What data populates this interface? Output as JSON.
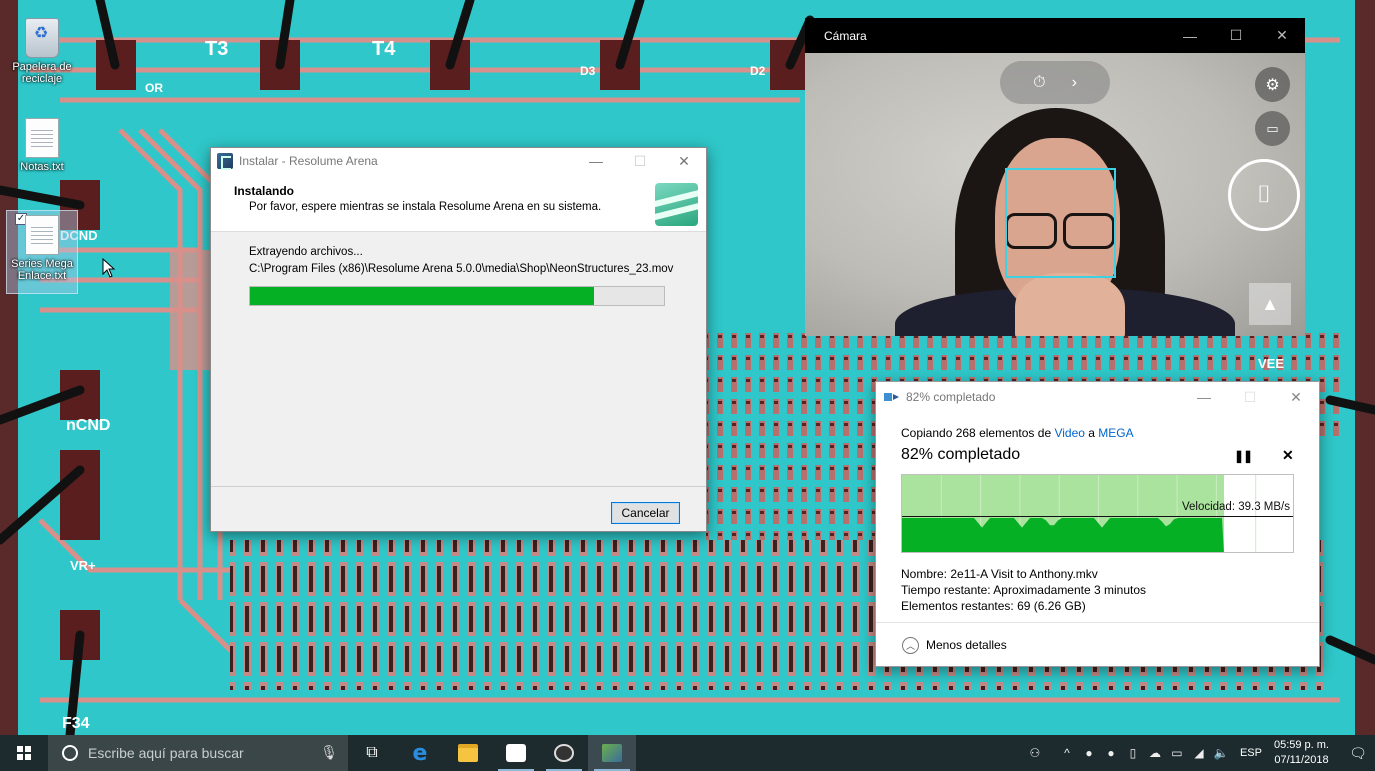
{
  "desktop": {
    "icons": [
      {
        "label": "Papelera de reciclaje",
        "icon": "recycle-bin-icon"
      },
      {
        "label": "Notas.txt",
        "icon": "text-file-icon"
      },
      {
        "label": "Series Mega Enlace.txt",
        "icon": "text-file-icon"
      }
    ],
    "wallpaper_text": [
      "T3",
      "T4",
      "OR",
      "DCND",
      "nCND",
      "VR+",
      "F34",
      "VEE",
      "D3",
      "D2"
    ]
  },
  "installer": {
    "title": "Instalar - Resolume Arena",
    "heading": "Instalando",
    "subheading": "Por favor, espere mientras se instala Resolume Arena en su sistema.",
    "status": "Extrayendo archivos...",
    "file_path": "C:\\Program Files (x86)\\Resolume Arena 5.0.0\\media\\Shop\\NeonStructures_23.mov",
    "progress": 0.83,
    "cancel_label": "Cancelar",
    "progress_color": "#06b025"
  },
  "camera": {
    "title": "Cámara",
    "timer_icon": "timer-icon",
    "expand_icon": "chevron-right-icon",
    "settings_icon": "gear-icon",
    "video_icon": "video-camera-icon",
    "photo_icon": "camera-icon",
    "gallery_icon": "gallery-icon"
  },
  "copy_dialog": {
    "title": "82% completado",
    "copying_prefix": "Copiando 268 elementos de ",
    "source": "Video",
    "connector": " a ",
    "destination": "MEGA",
    "percent_text": "82% completado",
    "progress": 0.82,
    "speed": "Velocidad: 39.3 MB/s",
    "name_label": "Nombre:",
    "name_value": "2e11-A Visit to Anthony.mkv",
    "time_label": "Tiempo restante:",
    "time_value": "Aproximadamente 3 minutos",
    "items_label": "Elementos restantes:",
    "items_value": "69 (6.26 GB)",
    "less_details": "Menos detalles",
    "link_color": "#0066cc",
    "graph_color": "#06b025"
  },
  "taskbar": {
    "search_placeholder": "Escribe aquí para buscar",
    "apps": [
      {
        "name": "task-view",
        "icon": "task-view-icon"
      },
      {
        "name": "edge",
        "icon": "edge-icon"
      },
      {
        "name": "file-explorer",
        "icon": "folder-icon"
      },
      {
        "name": "camera",
        "icon": "camera-icon"
      },
      {
        "name": "obs",
        "icon": "obs-icon"
      },
      {
        "name": "installer",
        "icon": "installer-icon"
      }
    ],
    "language": "ESP",
    "time": "05:59 p. m.",
    "date": "07/11/2018"
  }
}
